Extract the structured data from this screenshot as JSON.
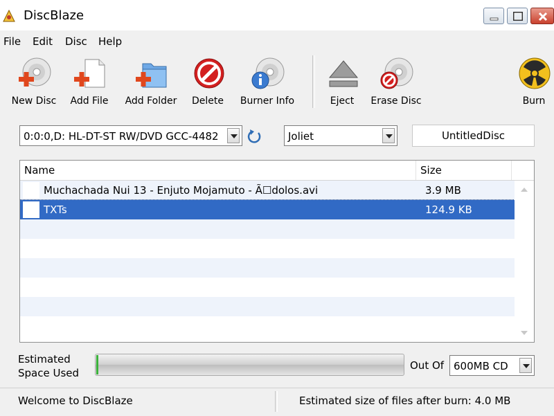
{
  "window": {
    "title": "DiscBlaze"
  },
  "menu": [
    "File",
    "Edit",
    "Disc",
    "Help"
  ],
  "toolbar": {
    "new_disc": "New Disc",
    "add_file": "Add File",
    "add_folder": "Add Folder",
    "delete": "Delete",
    "burner_info": "Burner Info",
    "eject": "Eject",
    "erase_disc": "Erase Disc",
    "burn": "Burn"
  },
  "drive": {
    "selected": "0:0:0,D: HL-DT-ST RW/DVD GCC-4482"
  },
  "filesystem": {
    "selected": "Joliet"
  },
  "disc_label": "UntitledDisc",
  "file_list": {
    "columns": {
      "name": "Name",
      "size": "Size"
    },
    "rows": [
      {
        "name": "Muchachada Nui 13 - Enjuto Mojamuto - Ã☐dolos.avi",
        "size": "3.9 MB",
        "selected": false
      },
      {
        "name": "TXTs",
        "size": "124.9 KB",
        "selected": true
      }
    ]
  },
  "space": {
    "label_line1": "Estimated",
    "label_line2": "Space Used",
    "used_fraction": 0.007,
    "out_of_label": "Out Of",
    "capacity": "600MB CD"
  },
  "status": {
    "left": "Welcome to DiscBlaze",
    "right": "Estimated size of files after burn: 4.0 MB"
  },
  "colors": {
    "selection": "#316ac5",
    "progress_fill": "#3bb23b"
  }
}
